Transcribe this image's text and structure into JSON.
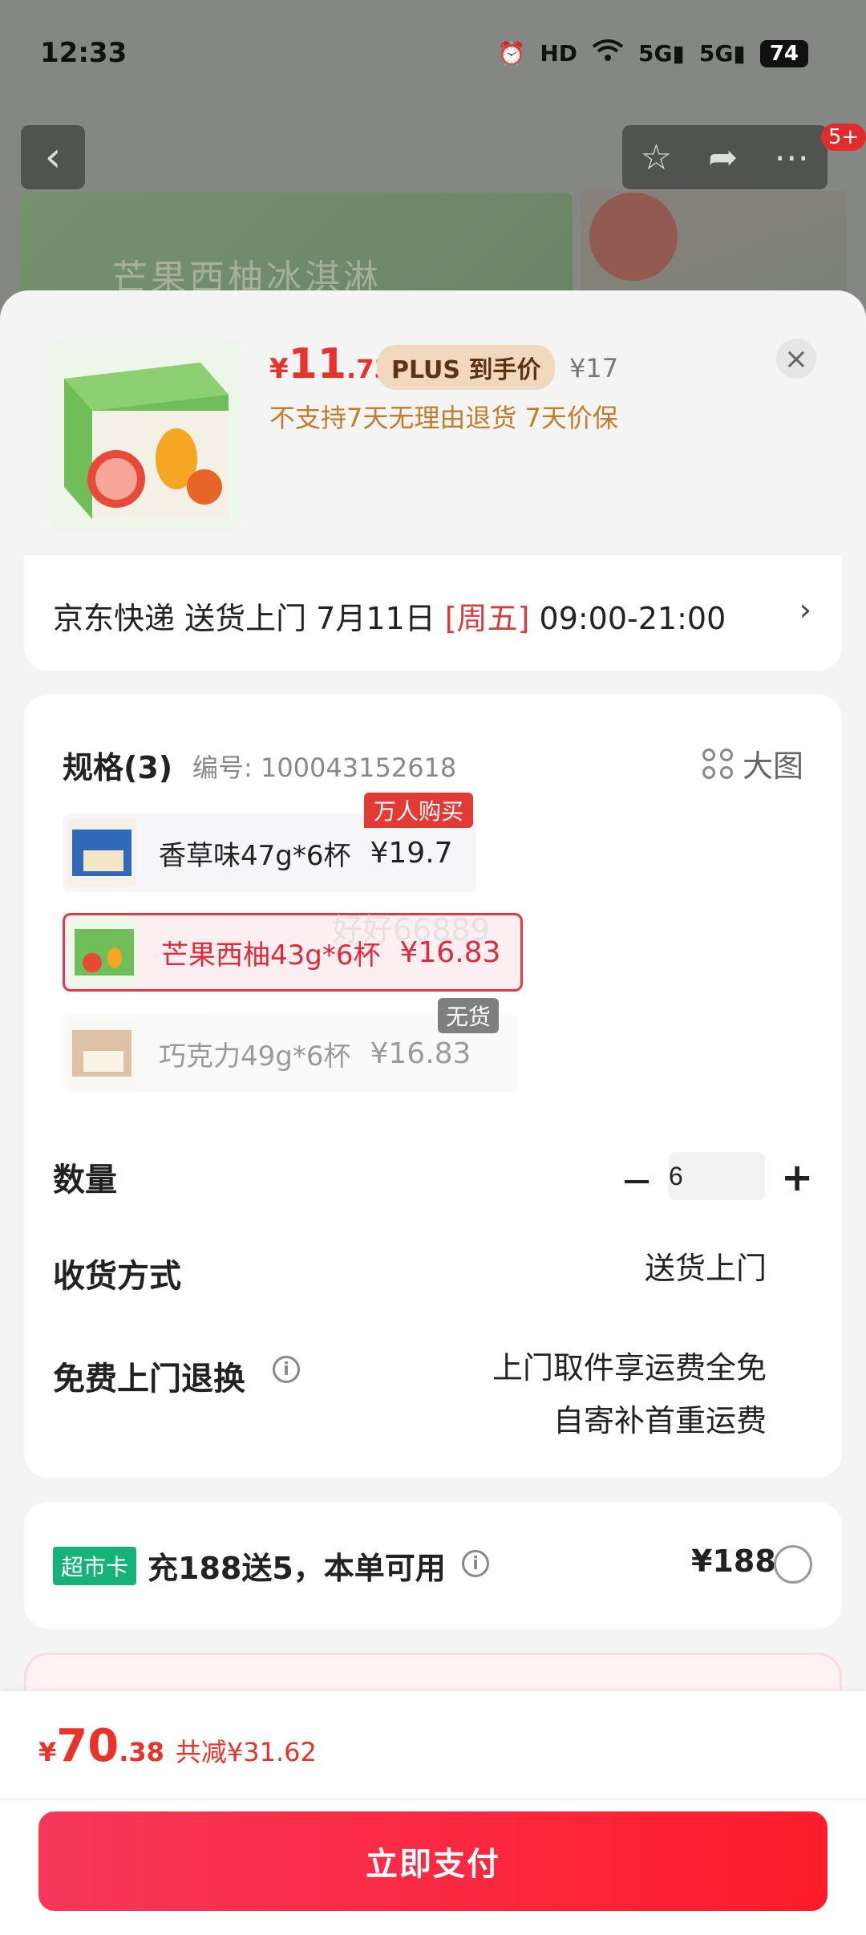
{
  "status_bar": {
    "time": "12:33",
    "hd": "HD",
    "net1": "5G",
    "net2": "5G",
    "battery": "74"
  },
  "top_nav": {
    "badge_count": "5+"
  },
  "background": {
    "product_text": "芒果西柚冰淇淋"
  },
  "sheet": {
    "price_symbol": "¥",
    "price_integer": "11",
    "price_decimal": ".73",
    "plus_tag": "PLUS 到手价",
    "original_price": "¥17",
    "policy": "不支持7天无理由退货  7天价保",
    "close_label": "×"
  },
  "shipping": {
    "text_before": "京东快递 送货上门 7月11日 ",
    "weekday": "[周五]",
    "text_after": " 09:00-21:00",
    "arrow": "›"
  },
  "spec": {
    "title": "规格(3)",
    "code": "编号: 100043152618",
    "big_image_label": "大图",
    "options": [
      {
        "name": "香草味47g*6杯",
        "price": "¥19.7",
        "tag": "万人购买"
      },
      {
        "name": "芒果西柚43g*6杯",
        "price": "¥16.83",
        "selected": true
      },
      {
        "name": "巧克力49g*6杯",
        "price": "¥16.83",
        "tag": "无货"
      }
    ],
    "watermark": "好好66889"
  },
  "quantity": {
    "label": "数量",
    "value": "6",
    "minus": "−",
    "plus": "+"
  },
  "delivery": {
    "label": "收货方式",
    "value": "送货上门"
  },
  "free_return": {
    "label": "免费上门退换",
    "line1": "上门取件享运费全免",
    "line2": "自寄补首重运费",
    "info": "i"
  },
  "promo": {
    "chip": "超市卡",
    "text": "充188送5，本单可用",
    "price": "¥188",
    "info": "i"
  },
  "bottom": {
    "total_symbol": "¥",
    "total_integer": "70",
    "total_decimal": ".38",
    "saved": "共减¥31.62",
    "pay_button": "立即支付"
  },
  "colors": {
    "accent": "#e8322a",
    "promo_green": "#16b27a",
    "plus_bg": "#f3d8c0"
  }
}
